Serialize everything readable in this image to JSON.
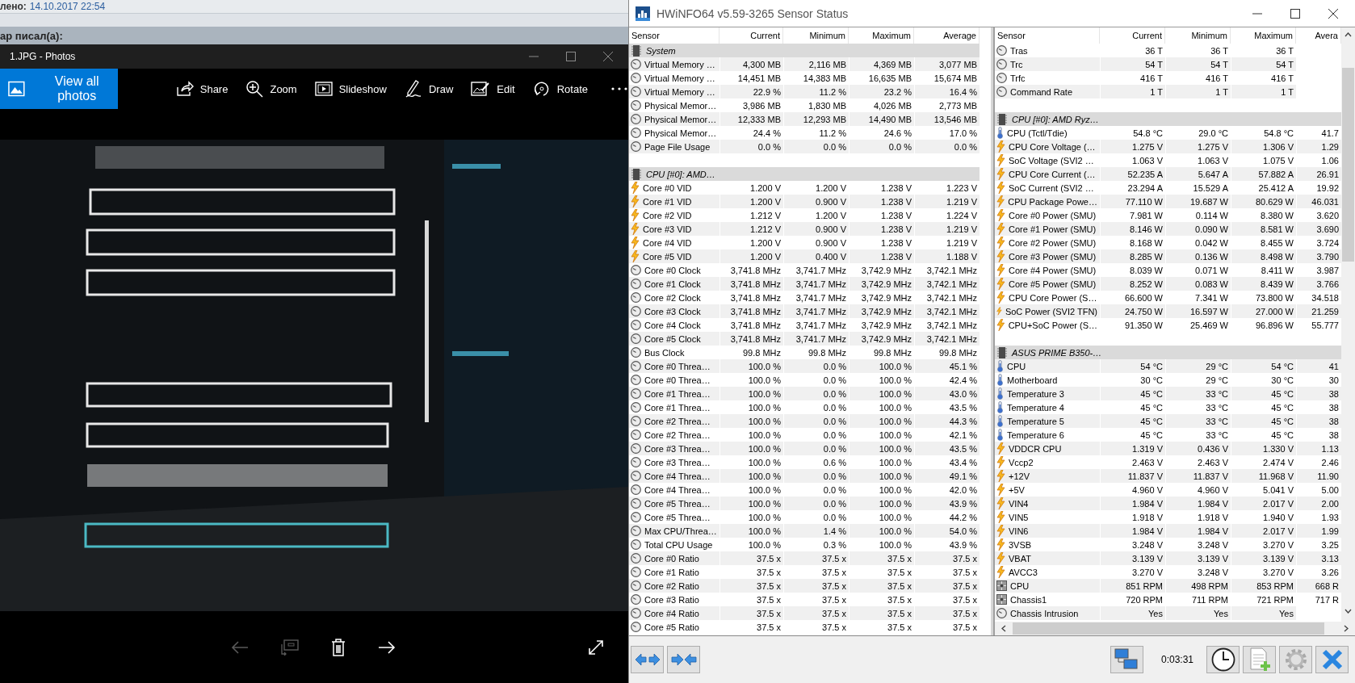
{
  "browser_page": {
    "post_label": "лено:",
    "post_date": "14.10.2017 22:54",
    "quote_header": "ар писал(а):"
  },
  "photos_window": {
    "title": "1.JPG - Photos",
    "view_all": "View all photos",
    "tools": [
      {
        "kind": "share",
        "label": "Share"
      },
      {
        "kind": "zoom",
        "label": "Zoom"
      },
      {
        "kind": "slideshow",
        "label": "Slideshow"
      },
      {
        "kind": "draw",
        "label": "Draw"
      },
      {
        "kind": "edit",
        "label": "Edit"
      },
      {
        "kind": "rotate",
        "label": "Rotate"
      }
    ],
    "controls": [
      {
        "kind": "previous",
        "disabled": true
      },
      {
        "kind": "cast",
        "disabled": true
      },
      {
        "kind": "delete",
        "disabled": false
      },
      {
        "kind": "next",
        "disabled": false
      },
      {
        "kind": "fullscreen",
        "disabled": false
      }
    ]
  },
  "hwinfo": {
    "title": "HWiNFO64 v5.59-3265 Sensor Status",
    "timer": "0:03:31",
    "left_panel": {
      "columns": [
        "Sensor",
        "Current",
        "Minimum",
        "Maximum",
        "Average"
      ],
      "rows": [
        {
          "kind": "group",
          "name": "System"
        },
        {
          "kind": "clock",
          "name": "Virtual Memory …",
          "values": [
            "4,300 MB",
            "2,116 MB",
            "4,369 MB",
            "3,077 MB"
          ]
        },
        {
          "kind": "clock",
          "name": "Virtual Memory …",
          "values": [
            "14,451 MB",
            "14,383 MB",
            "16,635 MB",
            "15,674 MB"
          ]
        },
        {
          "kind": "clock",
          "name": "Virtual Memory …",
          "values": [
            "22.9 %",
            "11.2 %",
            "23.2 %",
            "16.4 %"
          ]
        },
        {
          "kind": "clock",
          "name": "Physical Memor…",
          "values": [
            "3,986 MB",
            "1,830 MB",
            "4,026 MB",
            "2,773 MB"
          ]
        },
        {
          "kind": "clock",
          "name": "Physical Memor…",
          "values": [
            "12,333 MB",
            "12,293 MB",
            "14,490 MB",
            "13,546 MB"
          ]
        },
        {
          "kind": "clock",
          "name": "Physical Memor…",
          "values": [
            "24.4 %",
            "11.2 %",
            "24.6 %",
            "17.0 %"
          ]
        },
        {
          "kind": "clock",
          "name": "Page File Usage",
          "values": [
            "0.0 %",
            "0.0 %",
            "0.0 %",
            "0.0 %"
          ]
        },
        {
          "kind": "spacer"
        },
        {
          "kind": "group",
          "name": "CPU [#0]: AMD…"
        },
        {
          "kind": "voltage",
          "name": "Core #0 VID",
          "values": [
            "1.200 V",
            "1.200 V",
            "1.238 V",
            "1.223 V"
          ]
        },
        {
          "kind": "voltage",
          "name": "Core #1 VID",
          "values": [
            "1.200 V",
            "0.900 V",
            "1.238 V",
            "1.219 V"
          ]
        },
        {
          "kind": "voltage",
          "name": "Core #2 VID",
          "values": [
            "1.212 V",
            "1.200 V",
            "1.238 V",
            "1.224 V"
          ]
        },
        {
          "kind": "voltage",
          "name": "Core #3 VID",
          "values": [
            "1.212 V",
            "0.900 V",
            "1.238 V",
            "1.219 V"
          ]
        },
        {
          "kind": "voltage",
          "name": "Core #4 VID",
          "values": [
            "1.200 V",
            "0.900 V",
            "1.238 V",
            "1.219 V"
          ]
        },
        {
          "kind": "voltage",
          "name": "Core #5 VID",
          "values": [
            "1.200 V",
            "0.400 V",
            "1.238 V",
            "1.188 V"
          ]
        },
        {
          "kind": "clock",
          "name": "Core #0 Clock",
          "values": [
            "3,741.8 MHz",
            "3,741.7 MHz",
            "3,742.9 MHz",
            "3,742.1 MHz"
          ]
        },
        {
          "kind": "clock",
          "name": "Core #1 Clock",
          "values": [
            "3,741.8 MHz",
            "3,741.7 MHz",
            "3,742.9 MHz",
            "3,742.1 MHz"
          ]
        },
        {
          "kind": "clock",
          "name": "Core #2 Clock",
          "values": [
            "3,741.8 MHz",
            "3,741.7 MHz",
            "3,742.9 MHz",
            "3,742.1 MHz"
          ]
        },
        {
          "kind": "clock",
          "name": "Core #3 Clock",
          "values": [
            "3,741.8 MHz",
            "3,741.7 MHz",
            "3,742.9 MHz",
            "3,742.1 MHz"
          ]
        },
        {
          "kind": "clock",
          "name": "Core #4 Clock",
          "values": [
            "3,741.8 MHz",
            "3,741.7 MHz",
            "3,742.9 MHz",
            "3,742.1 MHz"
          ]
        },
        {
          "kind": "clock",
          "name": "Core #5 Clock",
          "values": [
            "3,741.8 MHz",
            "3,741.7 MHz",
            "3,742.9 MHz",
            "3,742.1 MHz"
          ]
        },
        {
          "kind": "clock",
          "name": "Bus Clock",
          "values": [
            "99.8 MHz",
            "99.8 MHz",
            "99.8 MHz",
            "99.8 MHz"
          ]
        },
        {
          "kind": "clock",
          "name": "Core #0 Threa…",
          "values": [
            "100.0 %",
            "0.0 %",
            "100.0 %",
            "45.1 %"
          ]
        },
        {
          "kind": "clock",
          "name": "Core #0 Threa…",
          "values": [
            "100.0 %",
            "0.0 %",
            "100.0 %",
            "42.4 %"
          ]
        },
        {
          "kind": "clock",
          "name": "Core #1 Threa…",
          "values": [
            "100.0 %",
            "0.0 %",
            "100.0 %",
            "43.0 %"
          ]
        },
        {
          "kind": "clock",
          "name": "Core #1 Threa…",
          "values": [
            "100.0 %",
            "0.0 %",
            "100.0 %",
            "43.5 %"
          ]
        },
        {
          "kind": "clock",
          "name": "Core #2 Threa…",
          "values": [
            "100.0 %",
            "0.0 %",
            "100.0 %",
            "44.3 %"
          ]
        },
        {
          "kind": "clock",
          "name": "Core #2 Threa…",
          "values": [
            "100.0 %",
            "0.0 %",
            "100.0 %",
            "42.1 %"
          ]
        },
        {
          "kind": "clock",
          "name": "Core #3 Threa…",
          "values": [
            "100.0 %",
            "0.0 %",
            "100.0 %",
            "43.5 %"
          ]
        },
        {
          "kind": "clock",
          "name": "Core #3 Threa…",
          "values": [
            "100.0 %",
            "0.6 %",
            "100.0 %",
            "43.4 %"
          ]
        },
        {
          "kind": "clock",
          "name": "Core #4 Threa…",
          "values": [
            "100.0 %",
            "0.0 %",
            "100.0 %",
            "49.1 %"
          ]
        },
        {
          "kind": "clock",
          "name": "Core #4 Threa…",
          "values": [
            "100.0 %",
            "0.0 %",
            "100.0 %",
            "42.0 %"
          ]
        },
        {
          "kind": "clock",
          "name": "Core #5 Threa…",
          "values": [
            "100.0 %",
            "0.0 %",
            "100.0 %",
            "43.9 %"
          ]
        },
        {
          "kind": "clock",
          "name": "Core #5 Threa…",
          "values": [
            "100.0 %",
            "0.0 %",
            "100.0 %",
            "44.2 %"
          ]
        },
        {
          "kind": "clock",
          "name": "Max CPU/Threa…",
          "values": [
            "100.0 %",
            "1.4 %",
            "100.0 %",
            "54.0 %"
          ]
        },
        {
          "kind": "clock",
          "name": "Total CPU Usage",
          "values": [
            "100.0 %",
            "0.3 %",
            "100.0 %",
            "43.9 %"
          ]
        },
        {
          "kind": "clock",
          "name": "Core #0 Ratio",
          "values": [
            "37.5 x",
            "37.5 x",
            "37.5 x",
            "37.5 x"
          ]
        },
        {
          "kind": "clock",
          "name": "Core #1 Ratio",
          "values": [
            "37.5 x",
            "37.5 x",
            "37.5 x",
            "37.5 x"
          ]
        },
        {
          "kind": "clock",
          "name": "Core #2 Ratio",
          "values": [
            "37.5 x",
            "37.5 x",
            "37.5 x",
            "37.5 x"
          ]
        },
        {
          "kind": "clock",
          "name": "Core #3 Ratio",
          "values": [
            "37.5 x",
            "37.5 x",
            "37.5 x",
            "37.5 x"
          ]
        },
        {
          "kind": "clock",
          "name": "Core #4 Ratio",
          "values": [
            "37.5 x",
            "37.5 x",
            "37.5 x",
            "37.5 x"
          ]
        },
        {
          "kind": "clock",
          "name": "Core #5 Ratio",
          "values": [
            "37.5 x",
            "37.5 x",
            "37.5 x",
            "37.5 x"
          ]
        }
      ]
    },
    "right_panel": {
      "columns": [
        "Sensor",
        "Current",
        "Minimum",
        "Maximum",
        "Avera"
      ],
      "rows": [
        {
          "kind": "clock",
          "name": "Tras",
          "values": [
            "36 T",
            "36 T",
            "36 T"
          ]
        },
        {
          "kind": "clock",
          "name": "Trc",
          "values": [
            "54 T",
            "54 T",
            "54 T"
          ]
        },
        {
          "kind": "clock",
          "name": "Trfc",
          "values": [
            "416 T",
            "416 T",
            "416 T"
          ]
        },
        {
          "kind": "clock",
          "name": "Command Rate",
          "values": [
            "1 T",
            "1 T",
            "1 T"
          ]
        },
        {
          "kind": "spacer"
        },
        {
          "kind": "group",
          "name": "CPU [#0]: AMD Ryz…"
        },
        {
          "kind": "temperature",
          "name": "CPU (Tctl/Tdie)",
          "values": [
            "54.8 °C",
            "29.0 °C",
            "54.8 °C",
            "41.7"
          ]
        },
        {
          "kind": "voltage",
          "name": "CPU Core Voltage (…",
          "values": [
            "1.275 V",
            "1.275 V",
            "1.306 V",
            "1.29"
          ]
        },
        {
          "kind": "voltage",
          "name": "SoC Voltage (SVI2 …",
          "values": [
            "1.063 V",
            "1.063 V",
            "1.075 V",
            "1.06"
          ]
        },
        {
          "kind": "voltage",
          "name": "CPU Core Current (…",
          "values": [
            "52.235 A",
            "5.647 A",
            "57.882 A",
            "26.91"
          ]
        },
        {
          "kind": "voltage",
          "name": "SoC Current (SVI2 …",
          "values": [
            "23.294 A",
            "15.529 A",
            "25.412 A",
            "19.92"
          ]
        },
        {
          "kind": "voltage",
          "name": "CPU Package Powe…",
          "values": [
            "77.110 W",
            "19.687 W",
            "80.629 W",
            "46.031"
          ]
        },
        {
          "kind": "voltage",
          "name": "Core #0 Power (SMU)",
          "values": [
            "7.981 W",
            "0.114 W",
            "8.380 W",
            "3.620"
          ]
        },
        {
          "kind": "voltage",
          "name": "Core #1 Power (SMU)",
          "values": [
            "8.146 W",
            "0.090 W",
            "8.581 W",
            "3.690"
          ]
        },
        {
          "kind": "voltage",
          "name": "Core #2 Power (SMU)",
          "values": [
            "8.168 W",
            "0.042 W",
            "8.455 W",
            "3.724"
          ]
        },
        {
          "kind": "voltage",
          "name": "Core #3 Power (SMU)",
          "values": [
            "8.285 W",
            "0.136 W",
            "8.498 W",
            "3.790"
          ]
        },
        {
          "kind": "voltage",
          "name": "Core #4 Power (SMU)",
          "values": [
            "8.039 W",
            "0.071 W",
            "8.411 W",
            "3.987"
          ]
        },
        {
          "kind": "voltage",
          "name": "Core #5 Power (SMU)",
          "values": [
            "8.252 W",
            "0.083 W",
            "8.439 W",
            "3.766"
          ]
        },
        {
          "kind": "voltage",
          "name": "CPU Core Power (S…",
          "values": [
            "66.600 W",
            "7.341 W",
            "73.800 W",
            "34.518"
          ]
        },
        {
          "kind": "voltage",
          "name": "SoC Power (SVI2 TFN)",
          "values": [
            "24.750 W",
            "16.597 W",
            "27.000 W",
            "21.259"
          ]
        },
        {
          "kind": "voltage",
          "name": "CPU+SoC Power (S…",
          "values": [
            "91.350 W",
            "25.469 W",
            "96.896 W",
            "55.777"
          ]
        },
        {
          "kind": "spacer"
        },
        {
          "kind": "group",
          "name": "ASUS PRIME B350-…"
        },
        {
          "kind": "temperature",
          "name": "CPU",
          "values": [
            "54 °C",
            "29 °C",
            "54 °C",
            "41"
          ]
        },
        {
          "kind": "temperature",
          "name": "Motherboard",
          "values": [
            "30 °C",
            "29 °C",
            "30 °C",
            "30"
          ]
        },
        {
          "kind": "temperature",
          "name": "Temperature 3",
          "values": [
            "45 °C",
            "33 °C",
            "45 °C",
            "38"
          ]
        },
        {
          "kind": "temperature",
          "name": "Temperature 4",
          "values": [
            "45 °C",
            "33 °C",
            "45 °C",
            "38"
          ]
        },
        {
          "kind": "temperature",
          "name": "Temperature 5",
          "values": [
            "45 °C",
            "33 °C",
            "45 °C",
            "38"
          ]
        },
        {
          "kind": "temperature",
          "name": "Temperature 6",
          "values": [
            "45 °C",
            "33 °C",
            "45 °C",
            "38"
          ]
        },
        {
          "kind": "voltage",
          "name": "VDDCR CPU",
          "values": [
            "1.319 V",
            "0.436 V",
            "1.330 V",
            "1.13"
          ]
        },
        {
          "kind": "voltage",
          "name": "Vccp2",
          "values": [
            "2.463 V",
            "2.463 V",
            "2.474 V",
            "2.46"
          ]
        },
        {
          "kind": "voltage",
          "name": "+12V",
          "values": [
            "11.837 V",
            "11.837 V",
            "11.968 V",
            "11.90"
          ]
        },
        {
          "kind": "voltage",
          "name": "+5V",
          "values": [
            "4.960 V",
            "4.960 V",
            "5.041 V",
            "5.00"
          ]
        },
        {
          "kind": "voltage",
          "name": "VIN4",
          "values": [
            "1.984 V",
            "1.984 V",
            "2.017 V",
            "2.00"
          ]
        },
        {
          "kind": "voltage",
          "name": "VIN5",
          "values": [
            "1.918 V",
            "1.918 V",
            "1.940 V",
            "1.93"
          ]
        },
        {
          "kind": "voltage",
          "name": "VIN6",
          "values": [
            "1.984 V",
            "1.984 V",
            "2.017 V",
            "1.99"
          ]
        },
        {
          "kind": "voltage",
          "name": "3VSB",
          "values": [
            "3.248 V",
            "3.248 V",
            "3.270 V",
            "3.25"
          ]
        },
        {
          "kind": "voltage",
          "name": "VBAT",
          "values": [
            "3.139 V",
            "3.139 V",
            "3.139 V",
            "3.13"
          ]
        },
        {
          "kind": "voltage",
          "name": "AVCC3",
          "values": [
            "3.270 V",
            "3.248 V",
            "3.270 V",
            "3.26"
          ]
        },
        {
          "kind": "fan",
          "name": "CPU",
          "values": [
            "851 RPM",
            "498 RPM",
            "853 RPM",
            "668 R"
          ]
        },
        {
          "kind": "fan",
          "name": "Chassis1",
          "values": [
            "720 RPM",
            "711 RPM",
            "721 RPM",
            "717 R"
          ]
        },
        {
          "kind": "clock",
          "name": "Chassis Intrusion",
          "values": [
            "Yes",
            "Yes",
            "Yes"
          ]
        }
      ]
    }
  }
}
